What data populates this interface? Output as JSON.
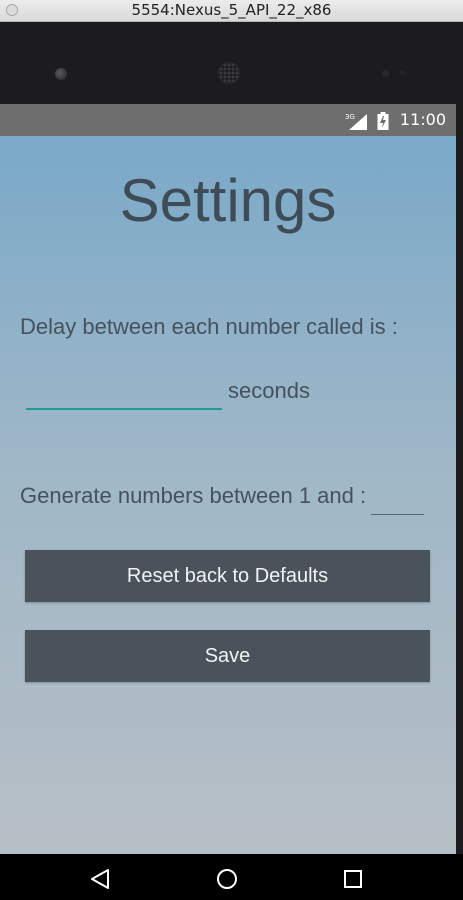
{
  "window": {
    "title": "5554:Nexus_5_API_22_x86"
  },
  "status_bar": {
    "time": "11:00",
    "network_label": "3G",
    "icons": [
      "signal-icon",
      "battery-icon"
    ]
  },
  "settings": {
    "title": "Settings",
    "delay_label": "Delay between each number called is :",
    "delay_value": "",
    "delay_unit": "seconds",
    "range_label": "Generate numbers between 1 and :",
    "range_max_value": "",
    "reset_button": "Reset back to Defaults",
    "save_button": "Save"
  },
  "nav_bar": {
    "icons": [
      "back-icon",
      "home-icon",
      "recents-icon"
    ]
  },
  "colors": {
    "accent": "#1e9e93",
    "button_bg": "#4a535b",
    "text": "#45525d",
    "gradient_top": "#7aa9c9",
    "gradient_bottom": "#b7bfc6"
  }
}
